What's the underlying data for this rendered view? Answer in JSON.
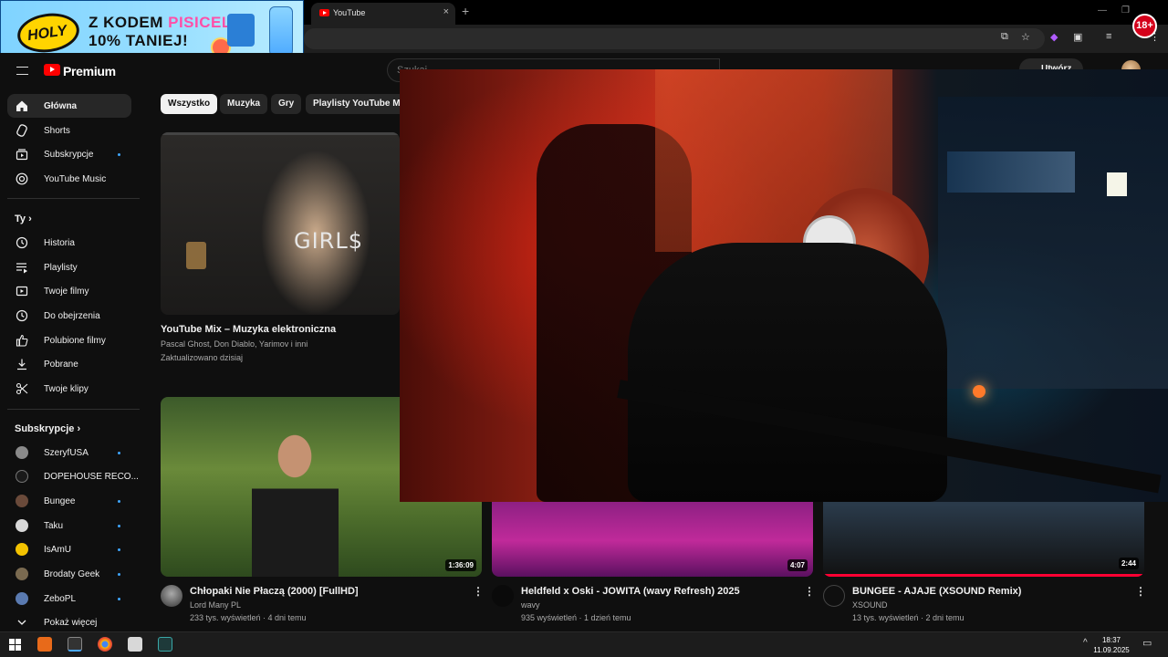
{
  "browser": {
    "tab_title": "YouTube",
    "tab_close": "×",
    "new_tab": "+",
    "win_minimize": "—",
    "win_restore": "❐",
    "win_close": "✕"
  },
  "ad": {
    "logo_text": "HOLY",
    "line1_prefix": "Z KODEM ",
    "line1_code": "PISICELA",
    "line2": "10% TANIEJ!",
    "age_badge": "18+"
  },
  "header": {
    "brand": "Premium",
    "search_placeholder": "Szukaj",
    "upload_label": "Utwórz"
  },
  "sidebar": {
    "main": [
      {
        "label": "Główna",
        "icon": "home-icon",
        "active": true
      },
      {
        "label": "Shorts",
        "icon": "shorts-icon"
      },
      {
        "label": "Subskrypcje",
        "icon": "subscriptions-icon",
        "dot": true
      },
      {
        "label": "YouTube Music",
        "icon": "music-icon"
      }
    ],
    "you_heading": "Ty",
    "you": [
      {
        "label": "Historia",
        "icon": "history-icon"
      },
      {
        "label": "Playlisty",
        "icon": "playlist-icon"
      },
      {
        "label": "Twoje filmy",
        "icon": "your-videos-icon"
      },
      {
        "label": "Do obejrzenia",
        "icon": "watch-later-icon"
      },
      {
        "label": "Polubione filmy",
        "icon": "thumbs-up-icon"
      },
      {
        "label": "Pobrane",
        "icon": "download-icon"
      },
      {
        "label": "Twoje klipy",
        "icon": "scissors-icon"
      }
    ],
    "subs_heading": "Subskrypcje",
    "subs": [
      {
        "label": "SzeryfUSA",
        "color": "#8a8a8a",
        "dot": true
      },
      {
        "label": "DOPEHOUSE RECO...",
        "color": "#1a1a1a"
      },
      {
        "label": "Bungee",
        "color": "#6a4a3a",
        "dot": true
      },
      {
        "label": "Taku",
        "color": "#d8d8d8",
        "dot": true
      },
      {
        "label": "IsAmU",
        "color": "#f2c200",
        "dot": true
      },
      {
        "label": "Brodaty Geek",
        "color": "#7a6a50",
        "dot": true
      },
      {
        "label": "ZeboPL",
        "color": "#5a7ab0",
        "dot": true
      }
    ],
    "show_more": "Pokaż więcej"
  },
  "chips": [
    "Wszystko",
    "Muzyka",
    "Gry",
    "Playlisty YouTube Mix"
  ],
  "featured": {
    "thumb_text": "GIRL$",
    "title": "YouTube Mix – Muzyka elektroniczna",
    "channels": "Pascal Ghost, Don Diablo, Yarimov i inni",
    "updated": "Zaktualizowano dzisiaj"
  },
  "videos": [
    {
      "title": "Chłopaki Nie Płaczą (2000) [FullHD]",
      "channel": "Lord Many PL",
      "meta": "233 tys. wyświetleń · 4 dni temu",
      "duration": "1:36:09"
    },
    {
      "title": "Heldfeld x Oski - JOWITA (wavy Refresh) 2025",
      "channel": "wavy",
      "meta": "935 wyświetleń · 1 dzień temu",
      "duration": "4:07"
    },
    {
      "title": "BUNGEE - AJAJE (XSOUND Remix)",
      "channel": "XSOUND",
      "meta": "13 tys. wyświetleń · 2 dni temu",
      "duration": "2:44"
    }
  ],
  "kebab": "⋮",
  "taskbar": {
    "time": "18:37",
    "date": "11.09.2025",
    "tray_arrow": "^"
  },
  "colors": {
    "accent_red": "#ff0000",
    "link_blue": "#3ea6ff",
    "background": "#0f0f0f"
  }
}
